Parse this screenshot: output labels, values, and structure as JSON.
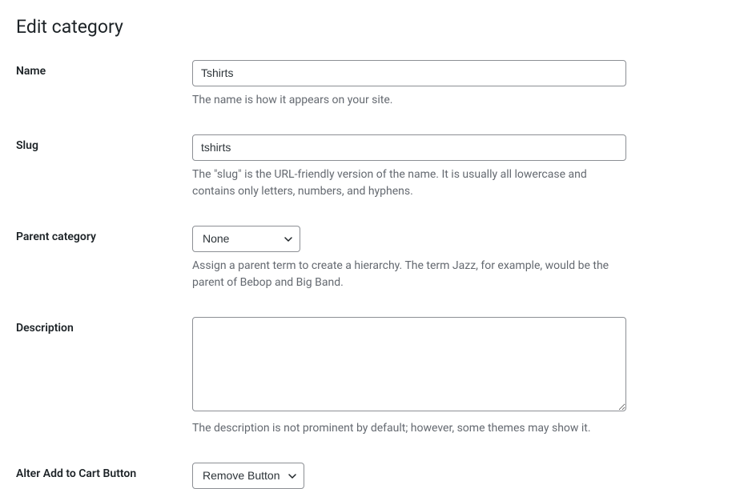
{
  "page": {
    "title": "Edit category"
  },
  "fields": {
    "name": {
      "label": "Name",
      "value": "Tshirts",
      "help": "The name is how it appears on your site."
    },
    "slug": {
      "label": "Slug",
      "value": "tshirts",
      "help": "The \"slug\" is the URL-friendly version of the name. It is usually all lowercase and contains only letters, numbers, and hyphens."
    },
    "parent": {
      "label": "Parent category",
      "value": "None",
      "help": "Assign a parent term to create a hierarchy. The term Jazz, for example, would be the parent of Bebop and Big Band."
    },
    "description": {
      "label": "Description",
      "value": "",
      "help": "The description is not prominent by default; however, some themes may show it."
    },
    "alter_add_to_cart": {
      "label": "Alter Add to Cart Button",
      "value": "Remove Button"
    }
  }
}
